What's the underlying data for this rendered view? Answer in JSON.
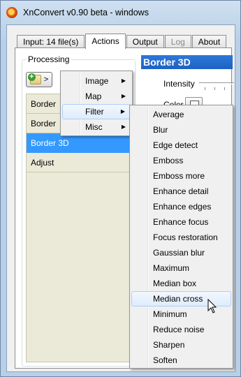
{
  "window": {
    "title": "XnConvert v0.90 beta - windows"
  },
  "tabs": [
    {
      "label": "Input: 14 file(s)",
      "active": false,
      "disabled": false
    },
    {
      "label": "Actions",
      "active": true,
      "disabled": false
    },
    {
      "label": "Output",
      "active": false,
      "disabled": false
    },
    {
      "label": "Log",
      "active": false,
      "disabled": true
    },
    {
      "label": "About",
      "active": false,
      "disabled": false
    }
  ],
  "processing": {
    "label": "Processing",
    "add_button_caret": ">",
    "actions": [
      {
        "label": "Border",
        "selected": false
      },
      {
        "label": "Border",
        "selected": false
      },
      {
        "label": "Border 3D",
        "selected": true
      },
      {
        "label": "Adjust",
        "selected": false
      }
    ]
  },
  "settings": {
    "header": "Border 3D",
    "intensity_label": "Intensity",
    "color_label": "Color"
  },
  "add_menu": {
    "items": [
      {
        "label": "Image",
        "has_submenu": true
      },
      {
        "label": "Map",
        "has_submenu": true
      },
      {
        "label": "Filter",
        "has_submenu": true,
        "hover": true
      },
      {
        "label": "Misc",
        "has_submenu": true
      }
    ]
  },
  "filter_submenu": {
    "items": [
      "Average",
      "Blur",
      "Edge detect",
      "Emboss",
      "Emboss more",
      "Enhance detail",
      "Enhance edges",
      "Enhance focus",
      "Focus restoration",
      "Gaussian blur",
      "Maximum",
      "Median box",
      "Median cross",
      "Minimum",
      "Reduce noise",
      "Sharpen",
      "Soften"
    ],
    "hovered": "Median cross"
  },
  "colors": {
    "selection": "#3399ff",
    "header": "#1d62c3",
    "list_bg": "#ebe9d8"
  }
}
